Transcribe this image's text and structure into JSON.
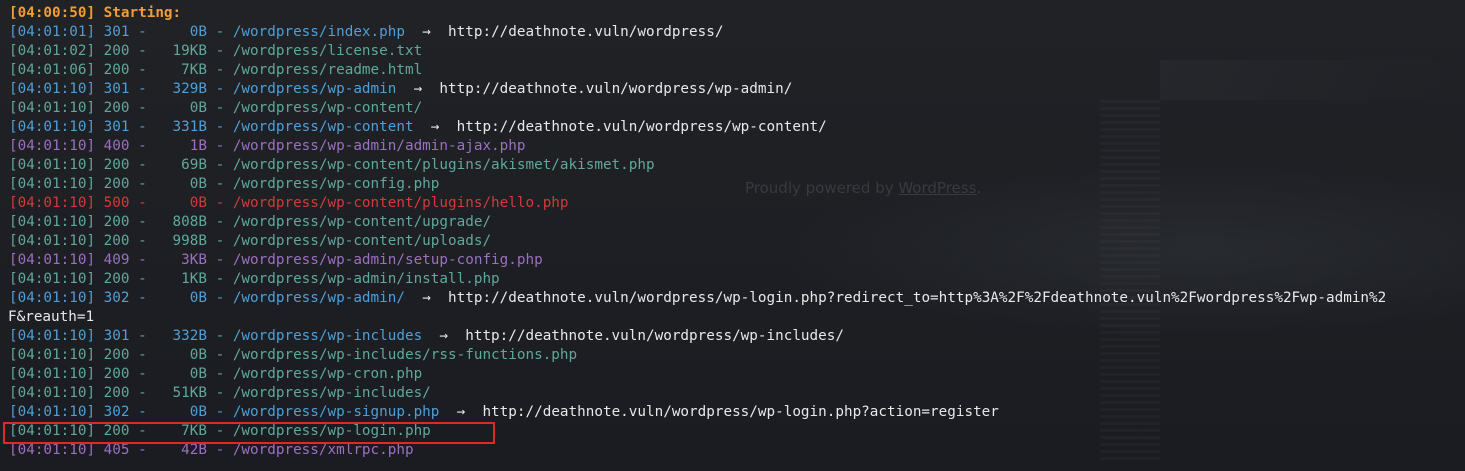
{
  "start_line": "[04:00:50] Starting:",
  "background_footer": {
    "prefix": "Proudly powered by ",
    "link": "WordPress",
    "suffix": "."
  },
  "results": [
    {
      "time": "[04:01:01]",
      "status": "301",
      "size": "0B",
      "path": "/wordpress/index.php",
      "redirect": "http://deathnote.vuln/wordpress/"
    },
    {
      "time": "[04:01:02]",
      "status": "200",
      "size": "19KB",
      "path": "/wordpress/license.txt",
      "redirect": ""
    },
    {
      "time": "[04:01:06]",
      "status": "200",
      "size": "7KB",
      "path": "/wordpress/readme.html",
      "redirect": ""
    },
    {
      "time": "[04:01:10]",
      "status": "301",
      "size": "329B",
      "path": "/wordpress/wp-admin",
      "redirect": "http://deathnote.vuln/wordpress/wp-admin/"
    },
    {
      "time": "[04:01:10]",
      "status": "200",
      "size": "0B",
      "path": "/wordpress/wp-content/",
      "redirect": ""
    },
    {
      "time": "[04:01:10]",
      "status": "301",
      "size": "331B",
      "path": "/wordpress/wp-content",
      "redirect": "http://deathnote.vuln/wordpress/wp-content/"
    },
    {
      "time": "[04:01:10]",
      "status": "400",
      "size": "1B",
      "path": "/wordpress/wp-admin/admin-ajax.php",
      "redirect": ""
    },
    {
      "time": "[04:01:10]",
      "status": "200",
      "size": "69B",
      "path": "/wordpress/wp-content/plugins/akismet/akismet.php",
      "redirect": ""
    },
    {
      "time": "[04:01:10]",
      "status": "200",
      "size": "0B",
      "path": "/wordpress/wp-config.php",
      "redirect": ""
    },
    {
      "time": "[04:01:10]",
      "status": "500",
      "size": "0B",
      "path": "/wordpress/wp-content/plugins/hello.php",
      "redirect": ""
    },
    {
      "time": "[04:01:10]",
      "status": "200",
      "size": "808B",
      "path": "/wordpress/wp-content/upgrade/",
      "redirect": ""
    },
    {
      "time": "[04:01:10]",
      "status": "200",
      "size": "998B",
      "path": "/wordpress/wp-content/uploads/",
      "redirect": ""
    },
    {
      "time": "[04:01:10]",
      "status": "409",
      "size": "3KB",
      "path": "/wordpress/wp-admin/setup-config.php",
      "redirect": ""
    },
    {
      "time": "[04:01:10]",
      "status": "200",
      "size": "1KB",
      "path": "/wordpress/wp-admin/install.php",
      "redirect": ""
    },
    {
      "time": "[04:01:10]",
      "status": "302",
      "size": "0B",
      "path": "/wordpress/wp-admin/",
      "redirect": "http://deathnote.vuln/wordpress/wp-login.php?redirect_to=http%3A%2F%2Fdeathnote.vuln%2Fwordpress%2Fwp-admin%2",
      "continuation": "F&reauth=1"
    },
    {
      "time": "[04:01:10]",
      "status": "301",
      "size": "332B",
      "path": "/wordpress/wp-includes",
      "redirect": "http://deathnote.vuln/wordpress/wp-includes/"
    },
    {
      "time": "[04:01:10]",
      "status": "200",
      "size": "0B",
      "path": "/wordpress/wp-includes/rss-functions.php",
      "redirect": ""
    },
    {
      "time": "[04:01:10]",
      "status": "200",
      "size": "0B",
      "path": "/wordpress/wp-cron.php",
      "redirect": ""
    },
    {
      "time": "[04:01:10]",
      "status": "200",
      "size": "51KB",
      "path": "/wordpress/wp-includes/",
      "redirect": ""
    },
    {
      "time": "[04:01:10]",
      "status": "302",
      "size": "0B",
      "path": "/wordpress/wp-signup.php",
      "redirect": "http://deathnote.vuln/wordpress/wp-login.php?action=register"
    },
    {
      "time": "[04:01:10]",
      "status": "200",
      "size": "7KB",
      "path": "/wordpress/wp-login.php",
      "redirect": "",
      "highlighted": true
    },
    {
      "time": "[04:01:10]",
      "status": "405",
      "size": "42B",
      "path": "/wordpress/xmlrpc.php",
      "redirect": ""
    }
  ],
  "arrow_glyph": "→",
  "colors": {
    "start": "#f39c32",
    "status_301": "#4e9fd8",
    "status_302": "#4e9fd8",
    "status_200": "#5fa89b",
    "status_4xx": "#9b6fc1",
    "status_500": "#d23b3b",
    "redirect_text": "#e8e8e8",
    "highlight_box": "#e02828",
    "background": "#1c1e24"
  }
}
